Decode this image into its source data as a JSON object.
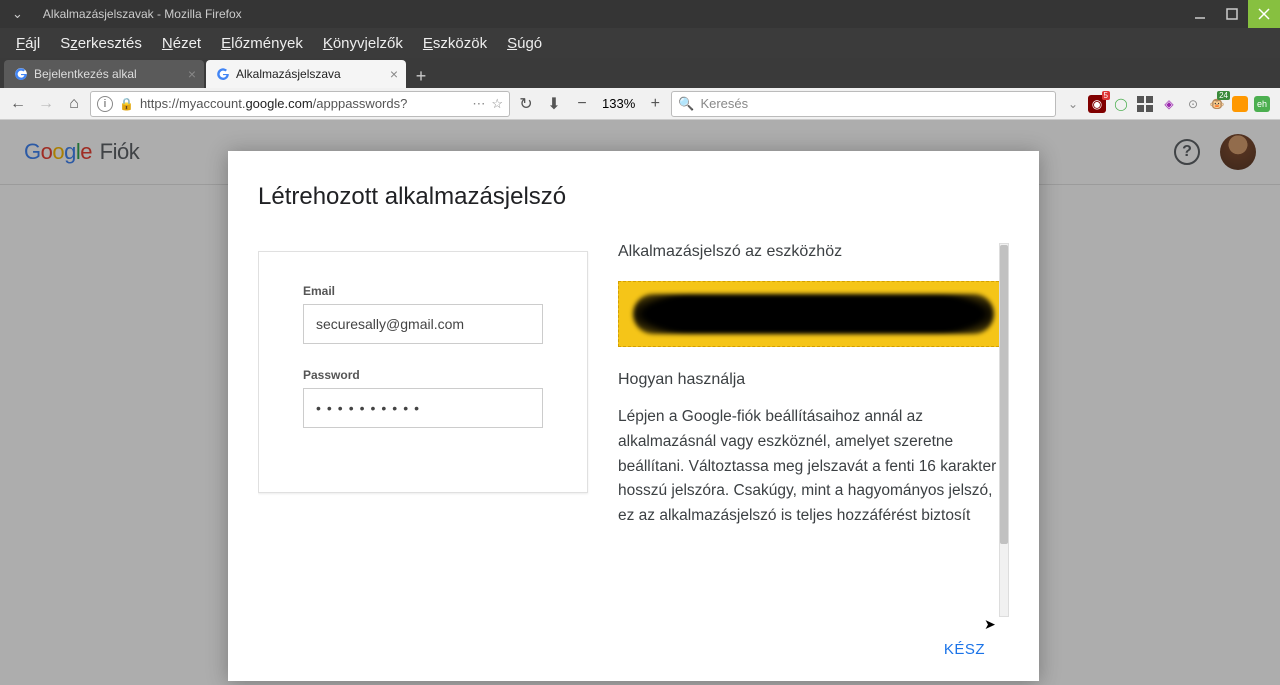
{
  "window": {
    "title": "Alkalmazásjelszavak - Mozilla Firefox"
  },
  "menubar": [
    "Fájl",
    "Szerkesztés",
    "Nézet",
    "Előzmények",
    "Könyvjelzők",
    "Eszközök",
    "Súgó"
  ],
  "tabs": [
    {
      "label": "Bejelentkezés alkal",
      "active": false
    },
    {
      "label": "Alkalmazásjelszava",
      "active": true
    }
  ],
  "url": {
    "prefix": "https://myaccount.",
    "domain": "google.com",
    "suffix": "/apppasswords?"
  },
  "zoom": "133%",
  "search": {
    "placeholder": "Keresés"
  },
  "addon_badges": {
    "ublock": "5",
    "grease": "24"
  },
  "google": {
    "product": "Fiók"
  },
  "modal": {
    "title": "Létrehozott alkalmazásjelszó",
    "email_label": "Email",
    "email_value": "securesally@gmail.com",
    "password_label": "Password",
    "password_dots": "••••••••••",
    "right_heading": "Alkalmazásjelszó az eszközhöz",
    "howto": "Hogyan használja",
    "instructions": "Lépjen a Google-fiók beállításaihoz annál az alkalmazásnál vagy eszköznél, amelyet szeretne beállítani. Változtassa meg jelszavát a fenti 16 karakter hosszú jelszóra. Csakúgy, mint a hagyományos jelszó, ez az alkalmazásjelszó is teljes hozzáférést biztosít",
    "done": "KÉSZ"
  }
}
